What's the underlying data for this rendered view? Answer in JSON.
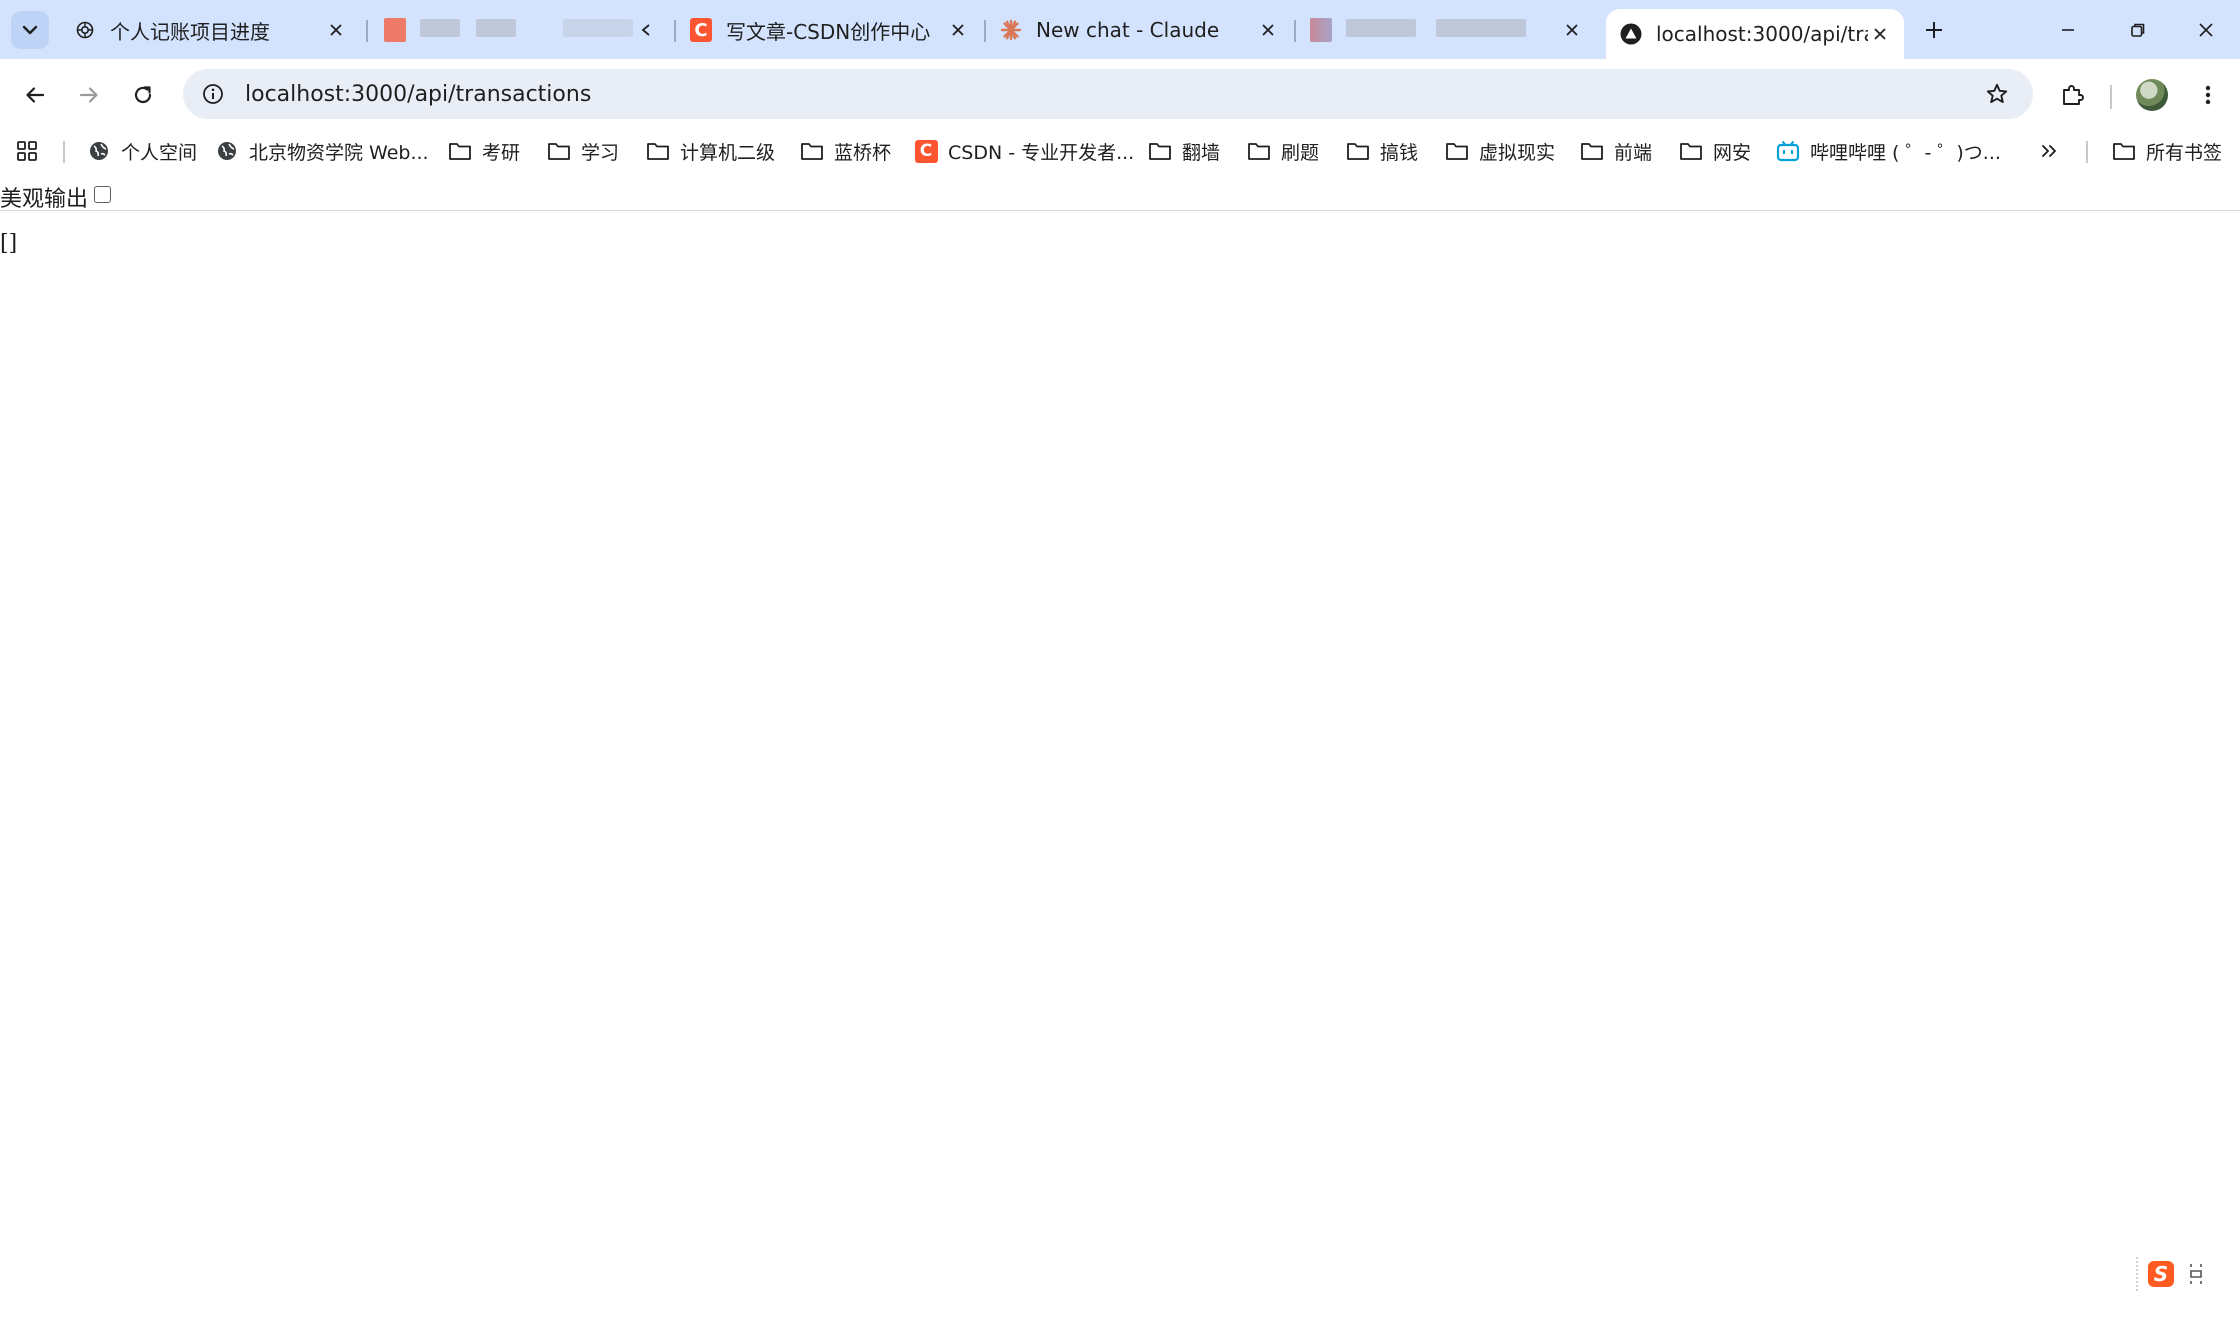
{
  "browser": {
    "tabs": [
      {
        "title": "个人记账项目进度",
        "favicon": "chatgpt-icon"
      },
      {
        "title": "",
        "favicon": "blurred-icon"
      },
      {
        "title": "写文章-CSDN创作中心",
        "favicon": "csdn-icon"
      },
      {
        "title": "New chat - Claude",
        "favicon": "claude-icon"
      },
      {
        "title": "",
        "favicon": "blurred-icon"
      },
      {
        "title": "localhost:3000/api/tran",
        "favicon": "vercel-icon",
        "active": true
      }
    ],
    "address": {
      "url": "localhost:3000/api/transactions"
    },
    "bookmarks": [
      {
        "label": "个人空间",
        "icon": "globe-icon"
      },
      {
        "label": "北京物资学院 Web...",
        "icon": "globe-icon"
      },
      {
        "label": "考研",
        "icon": "folder-icon"
      },
      {
        "label": "学习",
        "icon": "folder-icon"
      },
      {
        "label": "计算机二级",
        "icon": "folder-icon"
      },
      {
        "label": "蓝桥杯",
        "icon": "folder-icon"
      },
      {
        "label": "CSDN - 专业开发者...",
        "icon": "csdn-icon"
      },
      {
        "label": "翻墙",
        "icon": "folder-icon"
      },
      {
        "label": "刷题",
        "icon": "folder-icon"
      },
      {
        "label": "搞钱",
        "icon": "folder-icon"
      },
      {
        "label": "虚拟现实",
        "icon": "folder-icon"
      },
      {
        "label": "前端",
        "icon": "folder-icon"
      },
      {
        "label": "网安",
        "icon": "folder-icon"
      },
      {
        "label": "哔哩哔哩 ( ゜- ゜)つ...",
        "icon": "bilibili-icon"
      }
    ],
    "all_bookmarks_label": "所有书签",
    "colors": {
      "tabstrip": "#d3e3fd",
      "omnibox": "#e9eef6",
      "csdn": "#fc5531",
      "claude": "#d97757",
      "bilibili": "#00a1d6"
    }
  },
  "page": {
    "pretty_print_label": "美观输出",
    "pretty_print_checked": false,
    "json_body": "[]"
  },
  "ime": {
    "logo_letter": "S"
  }
}
